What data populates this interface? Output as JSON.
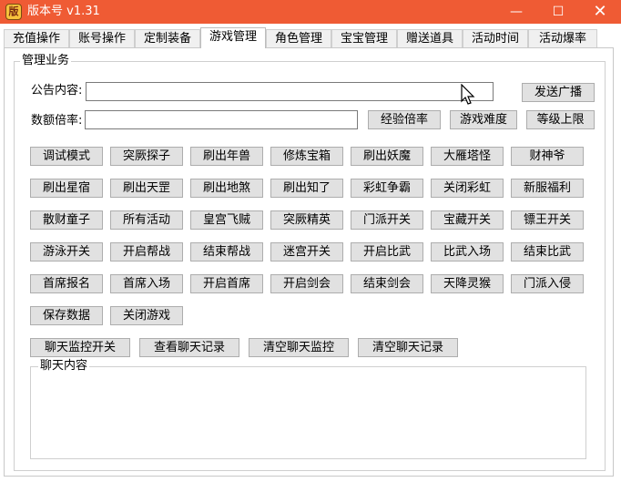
{
  "window": {
    "title": "版本号 v1.31",
    "icon": "app-logo-icon",
    "min_glyph": "—",
    "max_glyph": "☐",
    "close_glyph": "✕"
  },
  "tabs": [
    "充值操作",
    "账号操作",
    "定制装备",
    "游戏管理",
    "角色管理",
    "宝宝管理",
    "赠送道具",
    "活动时间",
    "活动爆率"
  ],
  "active_tab": "游戏管理",
  "group": {
    "title": "管理业务"
  },
  "announcement": {
    "label": "公告内容:",
    "value": "",
    "button": "发送广播"
  },
  "multiplier": {
    "label": "数额倍率:",
    "value": "",
    "buttons": [
      "经验倍率",
      "游戏难度",
      "等级上限"
    ]
  },
  "action_buttons": [
    [
      "调试模式",
      "突厥探子",
      "刷出年兽",
      "修炼宝箱",
      "刷出妖魔",
      "大雁塔怪",
      "财神爷"
    ],
    [
      "刷出星宿",
      "刷出天罡",
      "刷出地煞",
      "刷出知了",
      "彩虹争霸",
      "关闭彩虹",
      "新服福利"
    ],
    [
      "散财童子",
      "所有活动",
      "皇宫飞贼",
      "突厥精英",
      "门派开关",
      "宝藏开关",
      "镖王开关"
    ],
    [
      "游泳开关",
      "开启帮战",
      "结束帮战",
      "迷宫开关",
      "开启比武",
      "比武入场",
      "结束比武"
    ],
    [
      "首席报名",
      "首席入场",
      "开启首席",
      "开启剑会",
      "结束剑会",
      "天降灵猴",
      "门派入侵"
    ],
    [
      "保存数据",
      "关闭游戏"
    ]
  ],
  "chat_buttons": [
    "聊天监控开关",
    "查看聊天记录",
    "清空聊天监控",
    "清空聊天记录"
  ],
  "chat": {
    "title": "聊天内容"
  }
}
